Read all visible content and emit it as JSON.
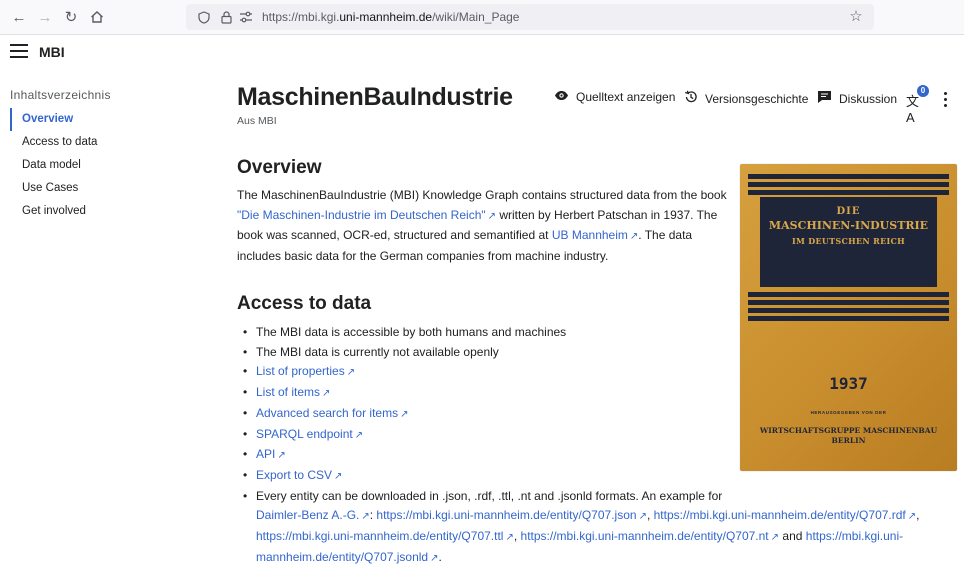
{
  "browser": {
    "url_prefix": "https://mbi.kgi.",
    "url_domain": "uni-mannheim.de",
    "url_path": "/wiki/Main_Page"
  },
  "site": {
    "name": "MBI"
  },
  "toc": {
    "title": "Inhaltsverzeichnis",
    "items": [
      {
        "label": "Overview",
        "active": true
      },
      {
        "label": "Access to data"
      },
      {
        "label": "Data model"
      },
      {
        "label": "Use Cases"
      },
      {
        "label": "Get involved"
      }
    ]
  },
  "page": {
    "title": "MaschinenBauIndustrie",
    "tagline": "Aus MBI",
    "tools": {
      "source": "Quelltext anzeigen",
      "history": "Versionsgeschichte",
      "discussion": "Diskussion",
      "lang_count": "0"
    }
  },
  "overview": {
    "heading": "Overview",
    "t1": "The MaschinenBauIndustrie (MBI) Knowledge Graph contains structured data from the book ",
    "book_link": "\"Die Maschinen-Industrie im Deutschen Reich\"",
    "t2": " written by Herbert Patschan in 1937. The book was scanned, OCR-ed, structured and semantified at ",
    "ub_link": "UB Mannheim",
    "t3": ". The data includes basic data for the German companies from machine industry."
  },
  "access": {
    "heading": "Access to data",
    "items": [
      "The MBI data is accessible by both humans and machines",
      "The MBI data is currently not available openly",
      "List of properties",
      "List of items",
      "Advanced search for items",
      "SPARQL endpoint",
      "API",
      "Export to CSV"
    ],
    "formats_text": "Every entity can be downloaded in .json, .rdf, .ttl, .nt and .jsonld formats. An example for",
    "example_link": "Daimler-Benz A.-G.",
    "json_link": "https://mbi.kgi.uni-mannheim.de/entity/Q707.json",
    "rdf_link": "https://mbi.kgi.uni-mannheim.de/entity/Q707.rdf",
    "ttl_link": "https://mbi.kgi.uni-mannheim.de/entity/Q707.ttl",
    "nt_link": "https://mbi.kgi.uni-mannheim.de/entity/Q707.nt",
    "and_text": "and",
    "jsonld_link_a": "https://mbi.kgi.uni-",
    "jsonld_link_b": "mannheim.de/entity/Q707.jsonld"
  },
  "cover": {
    "die": "DIE",
    "title": "MASCHINEN-INDUSTRIE",
    "subtitle": "IM DEUTSCHEN REICH",
    "year": "1937",
    "small": "HERAUSGEGEBEN VON DER",
    "publisher_1": "WIRTSCHAFTSGRUPPE MASCHINENBAU",
    "publisher_2": "BERLIN"
  }
}
